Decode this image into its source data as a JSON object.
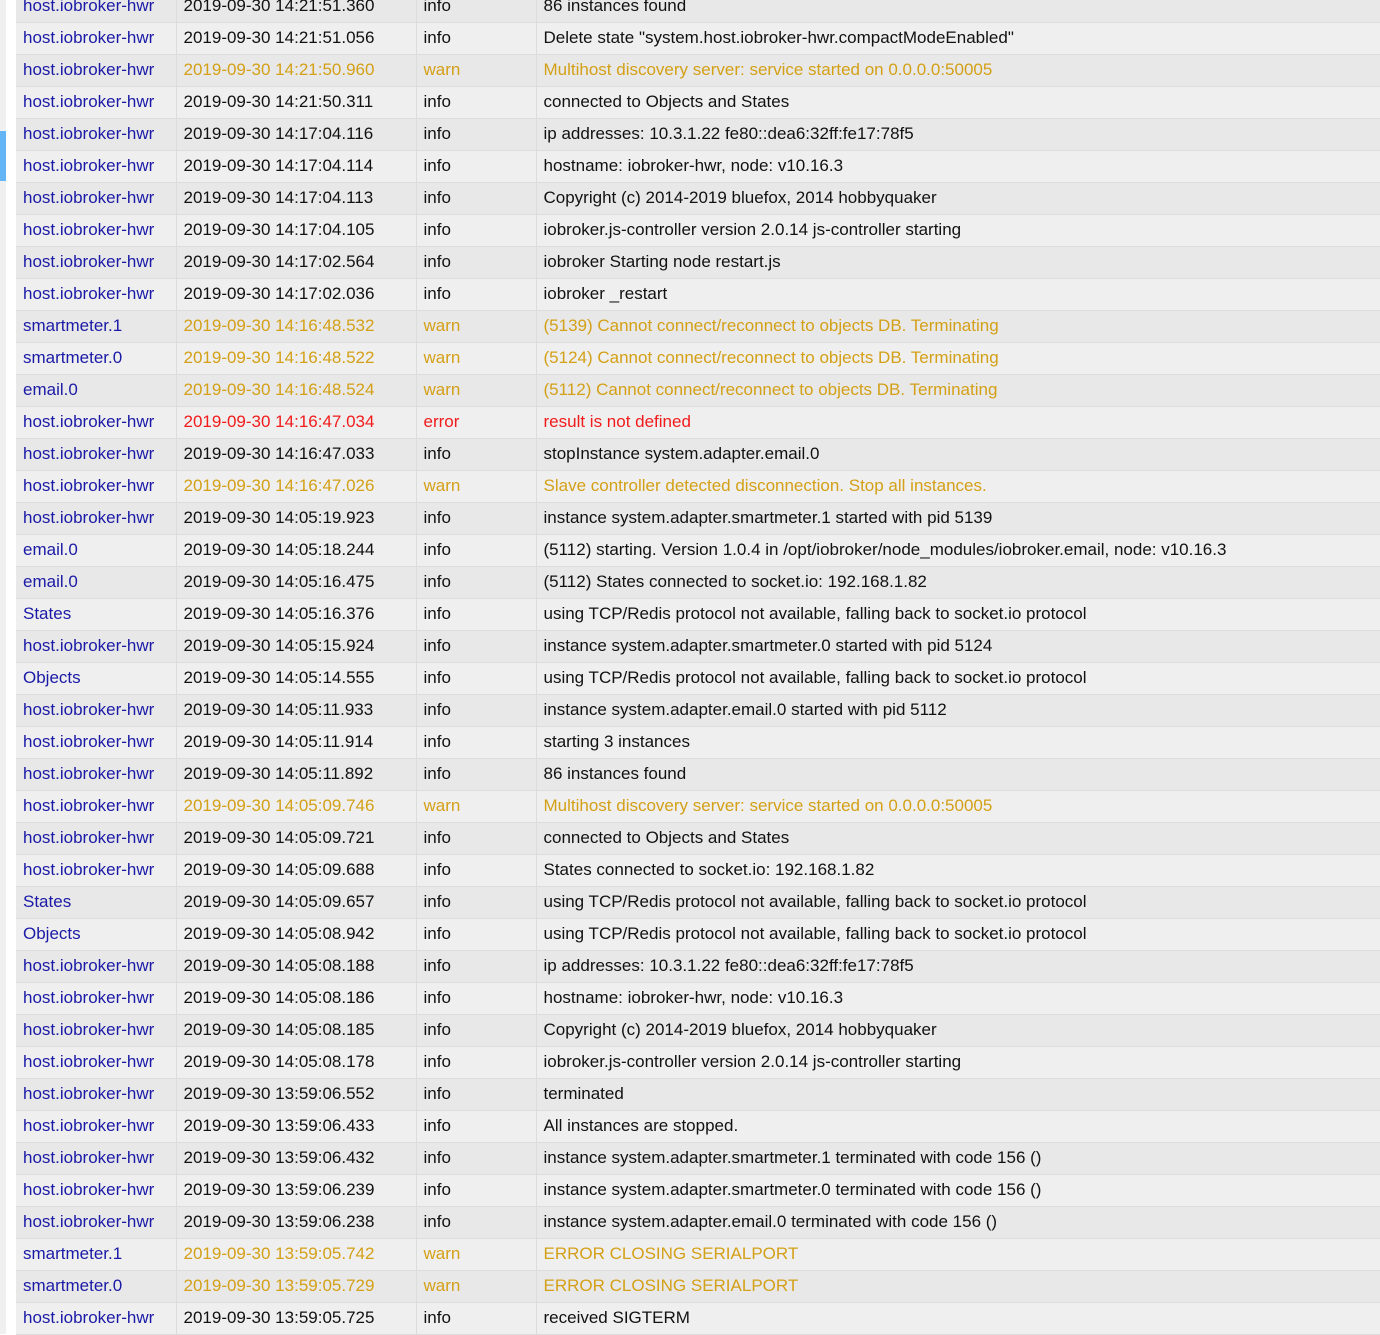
{
  "colors": {
    "source": "#1a1aa6",
    "info": "#111111",
    "warn": "#d4a017",
    "error": "#f21b1b",
    "scroll_marker": "#64b5f6"
  },
  "log": [
    {
      "source": "host.iobroker-hwr",
      "time": "2019-09-30 14:21:51.360",
      "severity": "info",
      "message": "86 instances found"
    },
    {
      "source": "host.iobroker-hwr",
      "time": "2019-09-30 14:21:51.056",
      "severity": "info",
      "message": "Delete state \"system.host.iobroker-hwr.compactModeEnabled\""
    },
    {
      "source": "host.iobroker-hwr",
      "time": "2019-09-30 14:21:50.960",
      "severity": "warn",
      "message": "Multihost discovery server: service started on 0.0.0.0:50005"
    },
    {
      "source": "host.iobroker-hwr",
      "time": "2019-09-30 14:21:50.311",
      "severity": "info",
      "message": "connected to Objects and States"
    },
    {
      "source": "host.iobroker-hwr",
      "time": "2019-09-30 14:17:04.116",
      "severity": "info",
      "message": "ip addresses: 10.3.1.22 fe80::dea6:32ff:fe17:78f5"
    },
    {
      "source": "host.iobroker-hwr",
      "time": "2019-09-30 14:17:04.114",
      "severity": "info",
      "message": "hostname: iobroker-hwr, node: v10.16.3"
    },
    {
      "source": "host.iobroker-hwr",
      "time": "2019-09-30 14:17:04.113",
      "severity": "info",
      "message": "Copyright (c) 2014-2019 bluefox, 2014 hobbyquaker"
    },
    {
      "source": "host.iobroker-hwr",
      "time": "2019-09-30 14:17:04.105",
      "severity": "info",
      "message": "iobroker.js-controller version 2.0.14 js-controller starting"
    },
    {
      "source": "host.iobroker-hwr",
      "time": "2019-09-30 14:17:02.564",
      "severity": "info",
      "message": "iobroker Starting node restart.js"
    },
    {
      "source": "host.iobroker-hwr",
      "time": "2019-09-30 14:17:02.036",
      "severity": "info",
      "message": "iobroker _restart"
    },
    {
      "source": "smartmeter.1",
      "time": "2019-09-30 14:16:48.532",
      "severity": "warn",
      "message": "(5139) Cannot connect/reconnect to objects DB. Terminating"
    },
    {
      "source": "smartmeter.0",
      "time": "2019-09-30 14:16:48.522",
      "severity": "warn",
      "message": "(5124) Cannot connect/reconnect to objects DB. Terminating"
    },
    {
      "source": "email.0",
      "time": "2019-09-30 14:16:48.524",
      "severity": "warn",
      "message": "(5112) Cannot connect/reconnect to objects DB. Terminating"
    },
    {
      "source": "host.iobroker-hwr",
      "time": "2019-09-30 14:16:47.034",
      "severity": "error",
      "message": "result is not defined"
    },
    {
      "source": "host.iobroker-hwr",
      "time": "2019-09-30 14:16:47.033",
      "severity": "info",
      "message": "stopInstance system.adapter.email.0"
    },
    {
      "source": "host.iobroker-hwr",
      "time": "2019-09-30 14:16:47.026",
      "severity": "warn",
      "message": "Slave controller detected disconnection. Stop all instances."
    },
    {
      "source": "host.iobroker-hwr",
      "time": "2019-09-30 14:05:19.923",
      "severity": "info",
      "message": "instance system.adapter.smartmeter.1 started with pid 5139"
    },
    {
      "source": "email.0",
      "time": "2019-09-30 14:05:18.244",
      "severity": "info",
      "message": "(5112) starting. Version 1.0.4 in /opt/iobroker/node_modules/iobroker.email, node: v10.16.3"
    },
    {
      "source": "email.0",
      "time": "2019-09-30 14:05:16.475",
      "severity": "info",
      "message": "(5112) States connected to socket.io: 192.168.1.82"
    },
    {
      "source": "States",
      "time": "2019-09-30 14:05:16.376",
      "severity": "info",
      "message": "using TCP/Redis protocol not available, falling back to socket.io protocol"
    },
    {
      "source": "host.iobroker-hwr",
      "time": "2019-09-30 14:05:15.924",
      "severity": "info",
      "message": "instance system.adapter.smartmeter.0 started with pid 5124"
    },
    {
      "source": "Objects",
      "time": "2019-09-30 14:05:14.555",
      "severity": "info",
      "message": "using TCP/Redis protocol not available, falling back to socket.io protocol"
    },
    {
      "source": "host.iobroker-hwr",
      "time": "2019-09-30 14:05:11.933",
      "severity": "info",
      "message": "instance system.adapter.email.0 started with pid 5112"
    },
    {
      "source": "host.iobroker-hwr",
      "time": "2019-09-30 14:05:11.914",
      "severity": "info",
      "message": "starting 3 instances"
    },
    {
      "source": "host.iobroker-hwr",
      "time": "2019-09-30 14:05:11.892",
      "severity": "info",
      "message": "86 instances found"
    },
    {
      "source": "host.iobroker-hwr",
      "time": "2019-09-30 14:05:09.746",
      "severity": "warn",
      "message": "Multihost discovery server: service started on 0.0.0.0:50005"
    },
    {
      "source": "host.iobroker-hwr",
      "time": "2019-09-30 14:05:09.721",
      "severity": "info",
      "message": "connected to Objects and States"
    },
    {
      "source": "host.iobroker-hwr",
      "time": "2019-09-30 14:05:09.688",
      "severity": "info",
      "message": "States connected to socket.io: 192.168.1.82"
    },
    {
      "source": "States",
      "time": "2019-09-30 14:05:09.657",
      "severity": "info",
      "message": "using TCP/Redis protocol not available, falling back to socket.io protocol"
    },
    {
      "source": "Objects",
      "time": "2019-09-30 14:05:08.942",
      "severity": "info",
      "message": "using TCP/Redis protocol not available, falling back to socket.io protocol"
    },
    {
      "source": "host.iobroker-hwr",
      "time": "2019-09-30 14:05:08.188",
      "severity": "info",
      "message": "ip addresses: 10.3.1.22 fe80::dea6:32ff:fe17:78f5"
    },
    {
      "source": "host.iobroker-hwr",
      "time": "2019-09-30 14:05:08.186",
      "severity": "info",
      "message": "hostname: iobroker-hwr, node: v10.16.3"
    },
    {
      "source": "host.iobroker-hwr",
      "time": "2019-09-30 14:05:08.185",
      "severity": "info",
      "message": "Copyright (c) 2014-2019 bluefox, 2014 hobbyquaker"
    },
    {
      "source": "host.iobroker-hwr",
      "time": "2019-09-30 14:05:08.178",
      "severity": "info",
      "message": "iobroker.js-controller version 2.0.14 js-controller starting"
    },
    {
      "source": "host.iobroker-hwr",
      "time": "2019-09-30 13:59:06.552",
      "severity": "info",
      "message": "terminated"
    },
    {
      "source": "host.iobroker-hwr",
      "time": "2019-09-30 13:59:06.433",
      "severity": "info",
      "message": "All instances are stopped."
    },
    {
      "source": "host.iobroker-hwr",
      "time": "2019-09-30 13:59:06.432",
      "severity": "info",
      "message": "instance system.adapter.smartmeter.1 terminated with code 156 ()"
    },
    {
      "source": "host.iobroker-hwr",
      "time": "2019-09-30 13:59:06.239",
      "severity": "info",
      "message": "instance system.adapter.smartmeter.0 terminated with code 156 ()"
    },
    {
      "source": "host.iobroker-hwr",
      "time": "2019-09-30 13:59:06.238",
      "severity": "info",
      "message": "instance system.adapter.email.0 terminated with code 156 ()"
    },
    {
      "source": "smartmeter.1",
      "time": "2019-09-30 13:59:05.742",
      "severity": "warn",
      "message": "ERROR CLOSING SERIALPORT"
    },
    {
      "source": "smartmeter.0",
      "time": "2019-09-30 13:59:05.729",
      "severity": "warn",
      "message": "ERROR CLOSING SERIALPORT"
    },
    {
      "source": "host.iobroker-hwr",
      "time": "2019-09-30 13:59:05.725",
      "severity": "info",
      "message": "received SIGTERM"
    }
  ]
}
